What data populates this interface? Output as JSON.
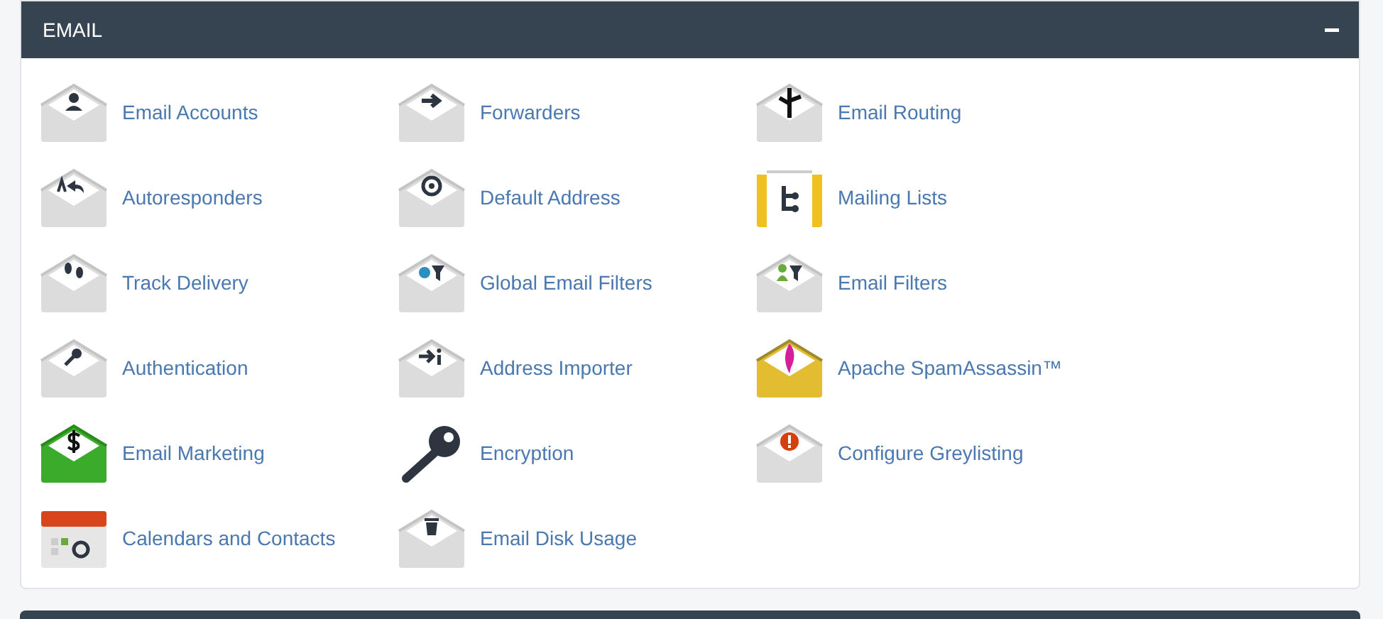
{
  "panel": {
    "title": "EMAIL",
    "expanded": true,
    "items": [
      {
        "label": "Email Accounts"
      },
      {
        "label": "Forwarders"
      },
      {
        "label": "Email Routing"
      },
      {
        "label": "Autoresponders"
      },
      {
        "label": "Default Address"
      },
      {
        "label": "Mailing Lists"
      },
      {
        "label": "Track Delivery"
      },
      {
        "label": "Global Email Filters"
      },
      {
        "label": "Email Filters"
      },
      {
        "label": "Authentication"
      },
      {
        "label": "Address Importer"
      },
      {
        "label": "Apache SpamAssassin™"
      },
      {
        "label": "Email Marketing"
      },
      {
        "label": "Encryption"
      },
      {
        "label": "Configure Greylisting"
      },
      {
        "label": "Calendars and Contacts"
      },
      {
        "label": "Email Disk Usage"
      }
    ]
  }
}
